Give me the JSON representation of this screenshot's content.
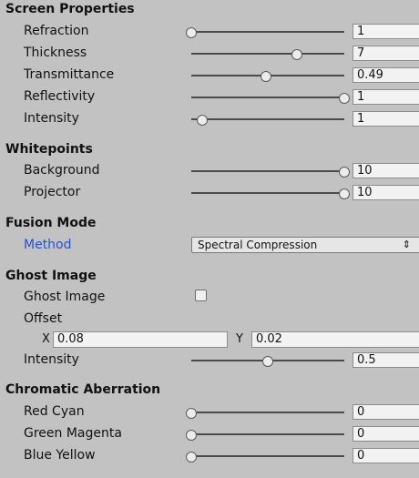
{
  "sections": {
    "screen": {
      "title": "Screen Properties",
      "rows": [
        {
          "label": "Refraction",
          "value": "1",
          "slider_fraction": 0.0
        },
        {
          "label": "Thickness",
          "value": "7",
          "slider_fraction": 0.69
        },
        {
          "label": "Transmittance",
          "value": "0.49",
          "slider_fraction": 0.49
        },
        {
          "label": "Reflectivity",
          "value": "1",
          "slider_fraction": 1.0
        },
        {
          "label": "Intensity",
          "value": "1",
          "slider_fraction": 0.07
        }
      ]
    },
    "whitepoints": {
      "title": "Whitepoints",
      "rows": [
        {
          "label": "Background",
          "value": "10",
          "slider_fraction": 1.0
        },
        {
          "label": "Projector",
          "value": "10",
          "slider_fraction": 1.0
        }
      ]
    },
    "fusion": {
      "title": "Fusion Mode",
      "method_label": "Method",
      "method_value": "Spectral Compression",
      "dropdown_arrow": "⇕"
    },
    "ghost": {
      "title": "Ghost Image",
      "toggle_label": "Ghost Image",
      "toggle_checked": false,
      "offset_label": "Offset",
      "x_label": "X",
      "x_value": "0.08",
      "y_label": "Y",
      "y_value": "0.02",
      "intensity_label": "Intensity",
      "intensity_value": "0.5",
      "intensity_fraction": 0.5
    },
    "chromatic": {
      "title": "Chromatic Aberration",
      "rows": [
        {
          "label": "Red Cyan",
          "value": "0",
          "slider_fraction": 0.0
        },
        {
          "label": "Green Magenta",
          "value": "0",
          "slider_fraction": 0.0
        },
        {
          "label": "Blue Yellow",
          "value": "0",
          "slider_fraction": 0.0
        }
      ]
    }
  },
  "colors": {
    "background": "#c2c2c2",
    "method_label": "#2b4fd6"
  }
}
